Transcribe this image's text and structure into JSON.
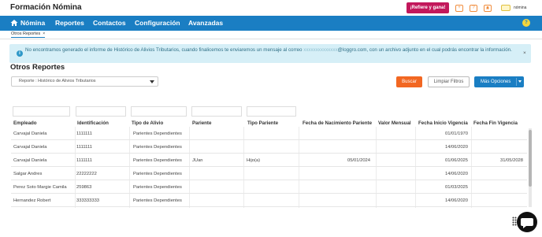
{
  "header": {
    "brand": "Formación Nómina",
    "refer_label": "¡Refiere y gana!",
    "icons": [
      "plus-icon",
      "help-icon",
      "bell-icon",
      "user-icon"
    ],
    "help_glyph": "?",
    "user_name": "nómina"
  },
  "nav": {
    "items": [
      "Nómina",
      "Reportes",
      "Contactos",
      "Configuración",
      "Avanzadas"
    ],
    "help_glyph": "?"
  },
  "tabs": [
    {
      "label": "Otros Reportes",
      "close": "×"
    }
  ],
  "alert": {
    "text_before": "No encontramos generado el informe de Histórico de Alivios Tributarios, cuando finalicemos te enviaremos un mensaje al correo",
    "masked_email": "xxxxxxxxxxxxxx",
    "text_after": "@loggro.com, con un archivo adjunto en el cual podrás encontrar la información.",
    "close": "×",
    "icon": "info-icon",
    "info_glyph": "i"
  },
  "page_title": "Otros Reportes",
  "report_select": {
    "value": "Reporte : Histórico de Alivios Tributarios"
  },
  "buttons": {
    "search": "Buscar",
    "clear": "Limpiar Filtros",
    "more": "Más Opciones"
  },
  "table": {
    "columns": [
      "Empleado",
      "Identificación",
      "Tipo de Alivio",
      "Pariente",
      "Tipo Pariente",
      "Fecha de Nacimiento Pariente",
      "Valor Mensual",
      "Fecha Inicio Vigencia",
      "Fecha Fin Vigencia"
    ],
    "rows": [
      [
        "Carvajal Daniela",
        "1111111",
        "Parientes Dependientes",
        "",
        "",
        "",
        "",
        "01/01/1970",
        ""
      ],
      [
        "Carvajal Daniela",
        "1111111",
        "Parientes Dependientes",
        "",
        "",
        "",
        "",
        "14/06/2020",
        ""
      ],
      [
        "Carvajal Daniela",
        "1111111",
        "Parientes Dependientes",
        "JUan",
        "Hijo(a)",
        "05/01/2024",
        "",
        "01/06/2025",
        "31/05/2028"
      ],
      [
        "Salgar Andres",
        "22222222",
        "Parientes Dependientes",
        "",
        "",
        "",
        "",
        "14/06/2020",
        ""
      ],
      [
        "Perez Soto Margie Camila",
        "259863",
        "Parientes Dependientes",
        "",
        "",
        "",
        "",
        "01/03/2025",
        ""
      ],
      [
        "Hernandez Robert",
        "333333333",
        "Parientes Dependientes",
        "",
        "",
        "",
        "",
        "14/06/2020",
        ""
      ]
    ]
  }
}
